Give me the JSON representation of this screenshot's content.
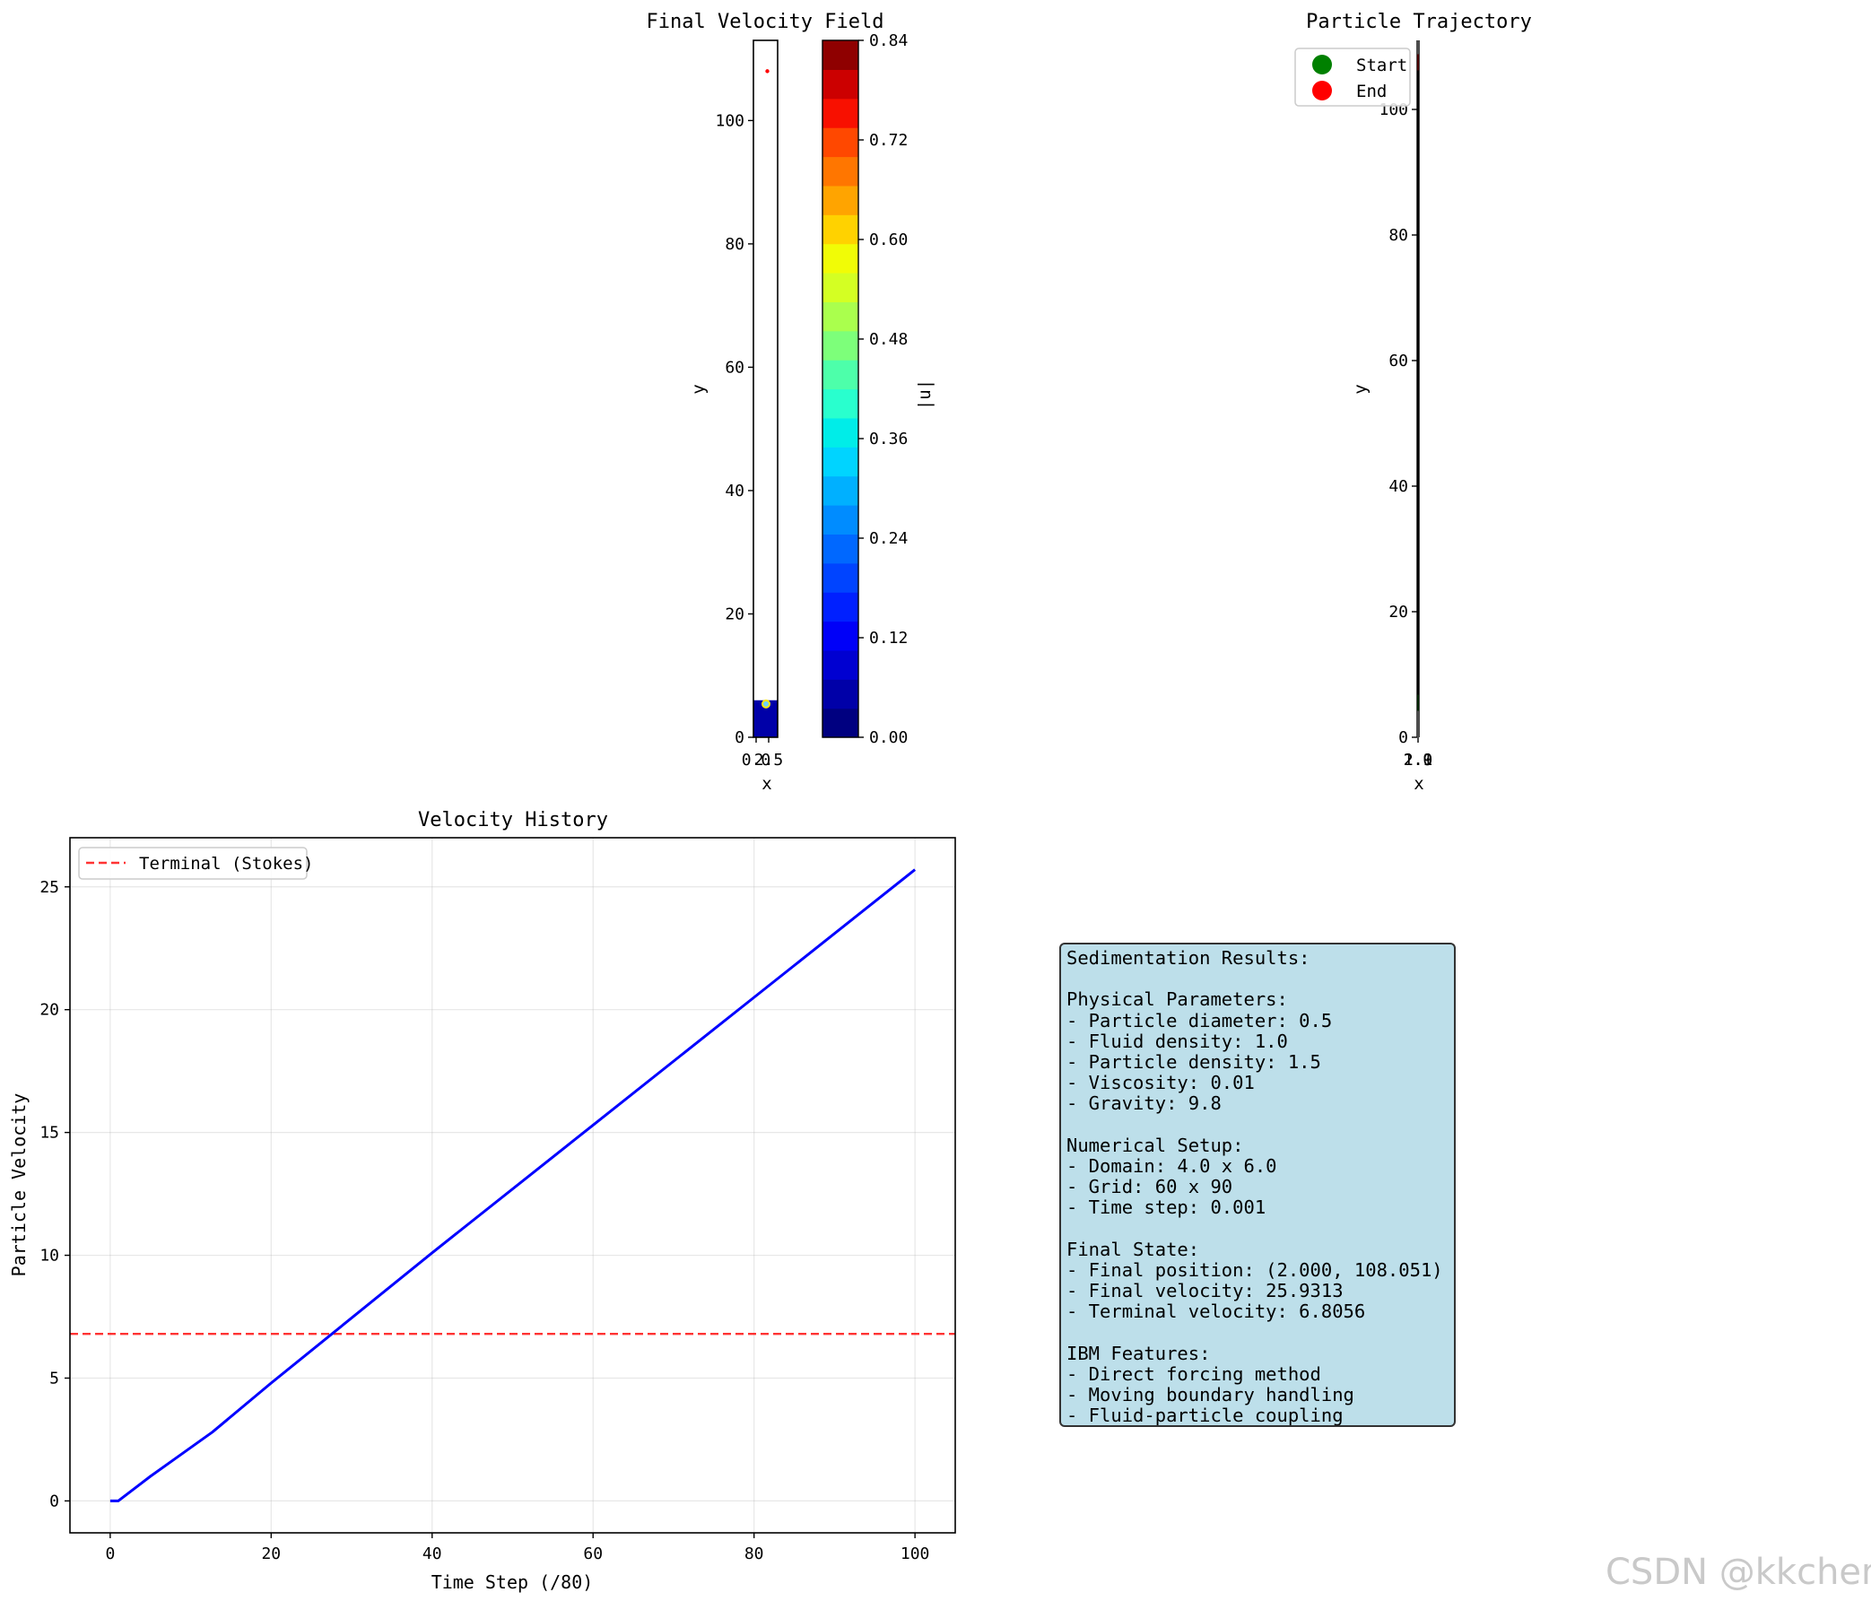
{
  "chart_data": [
    {
      "type": "heatmap",
      "title": "Final Velocity Field",
      "xlabel": "x",
      "ylabel": "y",
      "x_tick_labels": [
        "0.0",
        "2.5"
      ],
      "yticks": [
        0,
        20,
        40,
        60,
        80,
        100
      ],
      "ylim": [
        0,
        113
      ],
      "particle_marker_y": 108,
      "resolved_region_y": [
        0,
        6
      ],
      "colorbar": {
        "label": "|u|",
        "min": 0.0,
        "max": 0.84,
        "tick_labels": [
          "0.00",
          "0.12",
          "0.24",
          "0.36",
          "0.48",
          "0.60",
          "0.72",
          "0.84"
        ],
        "levels": 21,
        "colors": [
          "#000080",
          "#0000a8",
          "#0000d1",
          "#0000f8",
          "#0020ff",
          "#0044ff",
          "#0068ff",
          "#008cff",
          "#00b0ff",
          "#00d4ff",
          "#00ede8",
          "#29ffce",
          "#4dffaa",
          "#7dff7a",
          "#aaff4d",
          "#d4ff23",
          "#f1fc06",
          "#ffd200",
          "#ffa400",
          "#ff7600",
          "#ff4800",
          "#f81000",
          "#cc0000",
          "#8f0000"
        ]
      }
    },
    {
      "type": "line",
      "title": "Particle Trajectory",
      "xlabel": "x",
      "ylabel": "y",
      "x_tick_labels": [
        "1.9",
        "2.0",
        "2.1"
      ],
      "yticks": [
        0,
        20,
        40,
        60,
        80,
        100
      ],
      "ylim": [
        0,
        111
      ],
      "start_y": 5.5,
      "end_y": 107.5,
      "legend": [
        "Start",
        "End"
      ],
      "legend_position": "top-left",
      "colors": {
        "start": "#008000",
        "end": "#ff0000",
        "line": "#000000"
      }
    },
    {
      "type": "line",
      "title": "Velocity History",
      "xlabel": "Time Step (/80)",
      "ylabel": "Particle Velocity",
      "xticks": [
        0,
        20,
        40,
        60,
        80,
        100
      ],
      "yticks": [
        0,
        5,
        10,
        15,
        20,
        25
      ],
      "xlim": [
        -5,
        105
      ],
      "ylim": [
        -1.3,
        27
      ],
      "grid": true,
      "series": [
        {
          "x": [
            0,
            1,
            3,
            5,
            8,
            12.7,
            20,
            40,
            60,
            80,
            100
          ],
          "y": [
            0,
            0,
            0.5,
            1.0,
            1.7,
            2.8,
            4.8,
            10.1,
            15.3,
            20.5,
            25.7
          ],
          "color": "#0000ff"
        }
      ],
      "reference_lines": [
        {
          "name": "Terminal (Stokes)",
          "y": 6.8,
          "color": "#ff0000",
          "style": "dashed"
        }
      ],
      "legend_position": "top-left"
    }
  ],
  "results": {
    "lines": [
      "Sedimentation Results:",
      "",
      "Physical Parameters:",
      "- Particle diameter: 0.5",
      "- Fluid density: 1.0",
      "- Particle density: 1.5",
      "- Viscosity: 0.01",
      "- Gravity: 9.8",
      "",
      "Numerical Setup:",
      "- Domain: 4.0 x 6.0",
      "- Grid: 60 x 90",
      "- Time step: 0.001",
      "",
      "Final State:",
      "- Final position: (2.000, 108.051)",
      "- Final velocity: 25.9313",
      "- Terminal velocity: 6.8056",
      "",
      "IBM Features:",
      "- Direct forcing method",
      "- Moving boundary handling",
      "- Fluid-particle coupling"
    ]
  },
  "watermark": "CSDN @kkchenji"
}
